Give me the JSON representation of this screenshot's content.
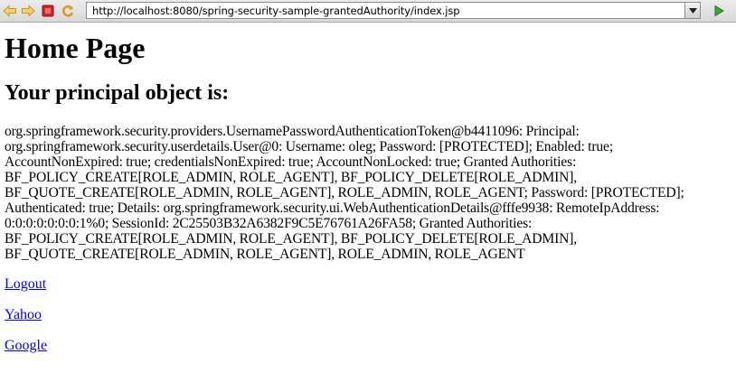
{
  "browser": {
    "url": "http://localhost:8080/spring-security-sample-grantedAuthority/index.jsp",
    "icons": {
      "back": "back-arrow-icon",
      "forward": "forward-arrow-icon",
      "stop": "stop-icon",
      "reload": "reload-icon",
      "dropdown": "chevron-down-icon",
      "go": "go-arrow-icon"
    },
    "colors": {
      "back_forward": "#e8b830",
      "stop": "#d02020",
      "reload": "#e8a020",
      "go": "#2c9a2c"
    }
  },
  "page": {
    "title": "Home Page",
    "subtitle": "Your principal object is:",
    "principal_text": "org.springframework.security.providers.UsernamePasswordAuthenticationToken@b4411096: Principal: org.springframework.security.userdetails.User@0: Username: oleg; Password: [PROTECTED]; Enabled: true; AccountNonExpired: true; credentialsNonExpired: true; AccountNonLocked: true; Granted Authorities: BF_POLICY_CREATE[ROLE_ADMIN, ROLE_AGENT], BF_POLICY_DELETE[ROLE_ADMIN], BF_QUOTE_CREATE[ROLE_ADMIN, ROLE_AGENT], ROLE_ADMIN, ROLE_AGENT; Password: [PROTECTED]; Authenticated: true; Details: org.springframework.security.ui.WebAuthenticationDetails@fffe9938: RemoteIpAddress: 0:0:0:0:0:0:0:1%0; SessionId: 2C25503B32A6382F9C5E76761A26FA58; Granted Authorities: BF_POLICY_CREATE[ROLE_ADMIN, ROLE_AGENT], BF_POLICY_DELETE[ROLE_ADMIN], BF_QUOTE_CREATE[ROLE_ADMIN, ROLE_AGENT], ROLE_ADMIN, ROLE_AGENT",
    "links": {
      "logout": "Logout",
      "yahoo": "Yahoo",
      "google": "Google"
    },
    "link_color": "#0000ee"
  }
}
